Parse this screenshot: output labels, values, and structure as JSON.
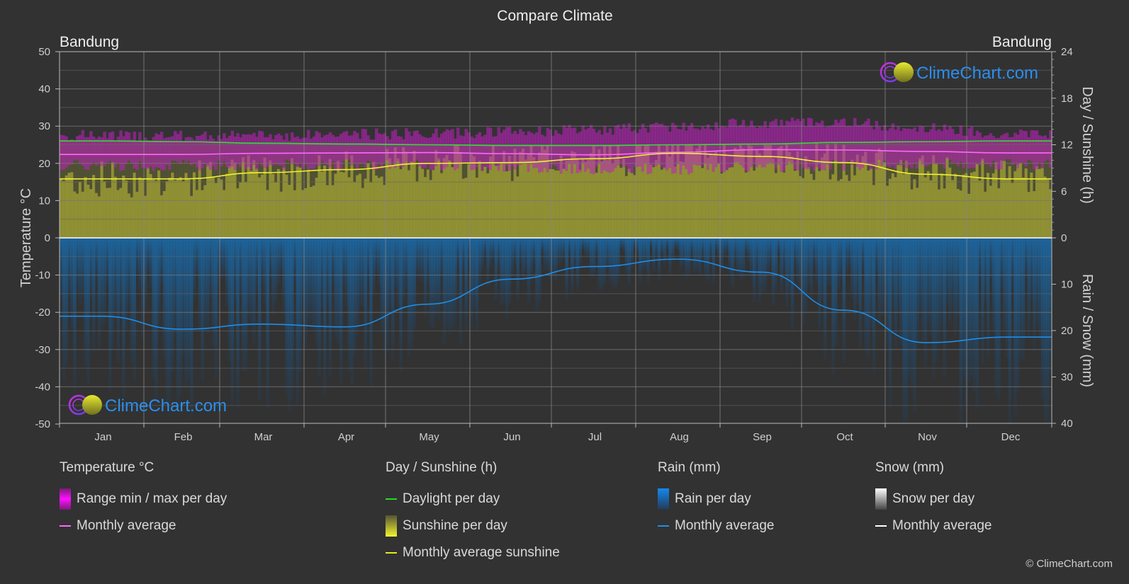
{
  "title": "Compare Climate",
  "location_left": "Bandung",
  "location_right": "Bandung",
  "watermark": "ClimeChart.com",
  "copyright": "© ClimeChart.com",
  "colors": {
    "background": "#323232",
    "temp_range": "#c020c0",
    "temp_avg": "#ff66ff",
    "daylight": "#33dd33",
    "sunshine_fill": "#9a9a30",
    "sunshine_avg": "#f0f030",
    "rain_fill": "#1a6aa8",
    "rain_avg": "#1e8ee8",
    "snow_avg": "#ffffff",
    "brand_blue": "#2a8ff0"
  },
  "chart_data": {
    "type": "line",
    "title": "Compare Climate",
    "categories": [
      "Jan",
      "Feb",
      "Mar",
      "Apr",
      "May",
      "Jun",
      "Jul",
      "Aug",
      "Sep",
      "Oct",
      "Nov",
      "Dec"
    ],
    "axes": {
      "left": {
        "label": "Temperature °C",
        "range": [
          -50,
          50
        ],
        "ticks": [
          "50",
          "40",
          "30",
          "20",
          "10",
          "0",
          "-10",
          "-20",
          "-30",
          "-40",
          "-50"
        ]
      },
      "right_top": {
        "label": "Day / Sunshine (h)",
        "range": [
          0,
          24
        ],
        "ticks": [
          "24",
          "18",
          "12",
          "6",
          "0"
        ]
      },
      "right_bottom": {
        "label": "Rain / Snow (mm)",
        "range": [
          0,
          40
        ],
        "ticks": [
          "10",
          "20",
          "30",
          "40"
        ]
      }
    },
    "grid": true,
    "series": [
      {
        "name": "Daylight per day",
        "axis": "right_top",
        "unit": "h",
        "values": [
          12.5,
          12.4,
          12.2,
          12.1,
          12.0,
          11.9,
          11.9,
          12.0,
          12.1,
          12.3,
          12.4,
          12.5
        ]
      },
      {
        "name": "Temperature monthly average",
        "axis": "left",
        "unit": "°C",
        "values": [
          22.4,
          22.4,
          22.7,
          22.8,
          22.9,
          22.6,
          22.3,
          23.0,
          23.7,
          23.6,
          23.2,
          22.8
        ]
      },
      {
        "name": "Temperature max per day (approx)",
        "axis": "left",
        "unit": "°C",
        "values": [
          27.5,
          27.3,
          27.5,
          27.8,
          28.0,
          28.5,
          29.0,
          30.0,
          31.0,
          31.0,
          29.5,
          28.0
        ]
      },
      {
        "name": "Temperature min per day (approx)",
        "axis": "left",
        "unit": "°C",
        "values": [
          19.5,
          19.5,
          19.5,
          19.8,
          19.5,
          19.0,
          18.5,
          18.5,
          19.0,
          19.5,
          19.8,
          19.8
        ]
      },
      {
        "name": "Monthly average sunshine",
        "axis": "right_top",
        "unit": "h",
        "values": [
          7.6,
          7.6,
          8.4,
          8.8,
          9.6,
          9.7,
          10.2,
          10.9,
          10.5,
          9.7,
          8.2,
          7.6
        ]
      },
      {
        "name": "Rain monthly average",
        "axis": "right_bottom",
        "unit": "mm",
        "values": [
          16.9,
          19.7,
          18.6,
          19.2,
          14.3,
          8.9,
          6.2,
          4.6,
          7.4,
          15.6,
          22.6,
          21.4
        ]
      },
      {
        "name": "Snow monthly average",
        "axis": "right_bottom",
        "unit": "mm",
        "values": [
          0,
          0,
          0,
          0,
          0,
          0,
          0,
          0,
          0,
          0,
          0,
          0
        ]
      }
    ]
  },
  "legend": {
    "temperature": {
      "title": "Temperature °C",
      "items": [
        "Range min / max per day",
        "Monthly average"
      ]
    },
    "sunshine": {
      "title": "Day / Sunshine (h)",
      "items": [
        "Daylight per day",
        "Sunshine per day",
        "Monthly average sunshine"
      ]
    },
    "rain": {
      "title": "Rain (mm)",
      "items": [
        "Rain per day",
        "Monthly average"
      ]
    },
    "snow": {
      "title": "Snow (mm)",
      "items": [
        "Snow per day",
        "Monthly average"
      ]
    }
  }
}
